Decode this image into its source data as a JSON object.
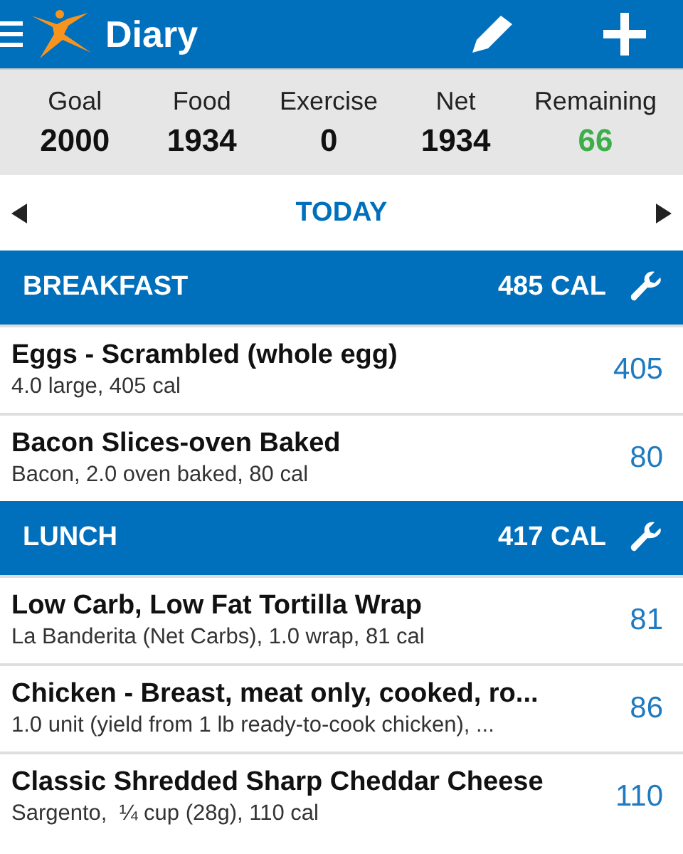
{
  "app_bar": {
    "title": "Diary"
  },
  "summary": [
    {
      "label": "Goal",
      "value": "2000",
      "color": "#111111"
    },
    {
      "label": "Food",
      "value": "1934",
      "color": "#111111"
    },
    {
      "label": "Exercise",
      "value": "0",
      "color": "#111111"
    },
    {
      "label": "Net",
      "value": "1934",
      "color": "#111111"
    },
    {
      "label": "Remaining",
      "value": "66",
      "color": "#3cae4a"
    }
  ],
  "date_nav": {
    "label": "TODAY"
  },
  "meals": [
    {
      "name": "BREAKFAST",
      "calories": "485 CAL",
      "entries": [
        {
          "name": "Eggs - Scrambled (whole egg)",
          "detail": "4.0 large, 405 cal",
          "calories": "405"
        },
        {
          "name": "Bacon Slices-oven Baked",
          "detail": "Bacon, 2.0 oven baked, 80 cal",
          "calories": "80"
        }
      ]
    },
    {
      "name": "LUNCH",
      "calories": "417 CAL",
      "entries": [
        {
          "name": "Low Carb, Low Fat Tortilla Wrap",
          "detail": "La Banderita (Net Carbs), 1.0 wrap, 81 cal",
          "calories": "81"
        },
        {
          "name": "Chicken - Breast, meat only, cooked, ro...",
          "detail": "1.0 unit (yield from 1 lb ready-to-cook chicken), ...",
          "calories": "86"
        },
        {
          "name": "Classic Shredded Sharp Cheddar Cheese",
          "detail": "Sargento,  ¼ cup (28g), 110 cal",
          "calories": "110"
        }
      ]
    }
  ]
}
